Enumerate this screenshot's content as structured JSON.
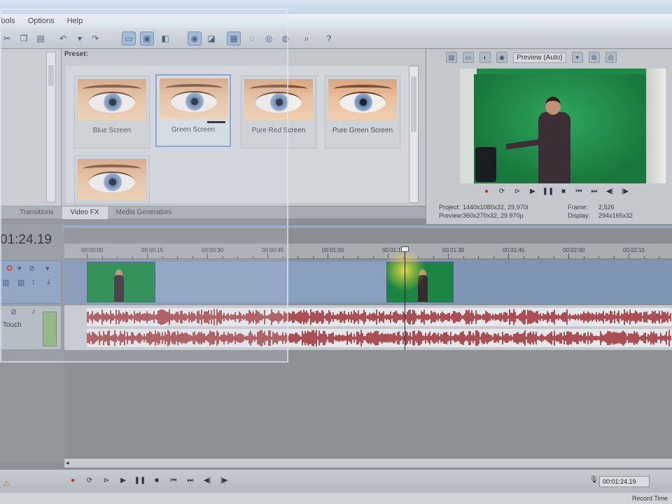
{
  "menu": {
    "items": [
      "Tools",
      "Options",
      "Help"
    ]
  },
  "fx": {
    "header": "Preset:",
    "presets": [
      {
        "label": "Blue Screen"
      },
      {
        "label": "Green Screen"
      },
      {
        "label": "Pure Red Screen"
      },
      {
        "label": "Pure Green Screen"
      },
      {
        "label": ""
      }
    ],
    "selected_index": 1
  },
  "tabs": [
    "Transitions",
    "Video FX",
    "Media Generators"
  ],
  "active_tab": "Video FX",
  "preview": {
    "mode_label": "Preview (Auto)",
    "info": {
      "project_label": "Project:",
      "project_value": "1440x1080x32, 29.970i",
      "preview_label": "Preview:",
      "preview_value": "360x270x32, 29.970p",
      "frame_label": "Frame:",
      "frame_value": "2,526",
      "display_label": "Display:",
      "display_value": "294x165x32"
    }
  },
  "timeline": {
    "timecode": "01:24.19",
    "ruler_labels": [
      "00:00:00",
      "00:00:15",
      "00:00:30",
      "00:00:45",
      "00:01:00",
      "00:01:15",
      "00:01:30",
      "00:01:45",
      "00:02:00",
      "00:02:15"
    ],
    "audio_mode": "Touch"
  },
  "bottom": {
    "timecode": "00:01:24.19"
  },
  "status": {
    "right_text": "Record Time"
  }
}
